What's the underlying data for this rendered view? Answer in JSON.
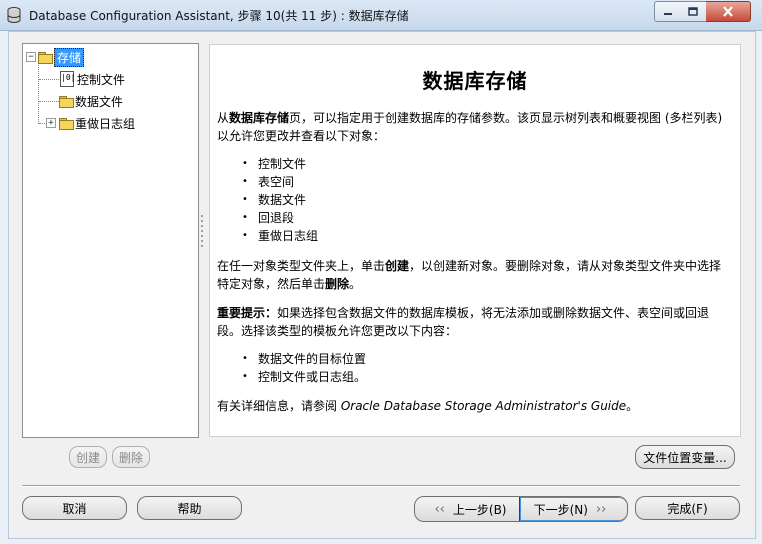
{
  "window": {
    "title": "Database Configuration Assistant, 步骤 10(共 11 步) : 数据库存储",
    "app_icon": "database-app-icon",
    "controls": [
      "minimize-icon",
      "maximize-icon",
      "close-icon"
    ]
  },
  "tree": {
    "root_label": "存储",
    "items": [
      {
        "label": "控制文件",
        "icon": "control-file-icon"
      },
      {
        "label": "数据文件",
        "icon": "folder-icon"
      },
      {
        "label": "重做日志组",
        "icon": "folder-icon"
      }
    ]
  },
  "content": {
    "title": "数据库存储",
    "intro_prefix": "从",
    "intro_bold": "数据库存储",
    "intro_rest": "页，可以指定用于创建数据库的存储参数。该页显示树列表和概要视图 (多栏列表) 以允许您更改并查看以下对象：",
    "objects": [
      "控制文件",
      "表空间",
      "数据文件",
      "回退段",
      "重做日志组"
    ],
    "create_para": {
      "p1": "在任一对象类型文件夹上，单击",
      "b1": "创建",
      "p2": "，以创建新对象。要删除对象，请从对象类型文件夹中选择特定对象，然后单击",
      "b2": "删除",
      "p3": "。"
    },
    "note": {
      "label": "重要提示：",
      "text": "如果选择包含数据文件的数据库模板，将无法添加或删除数据文件、表空间或回退段。选择该类型的模板允许您更改以下内容："
    },
    "changeable": [
      "数据文件的目标位置",
      "控制文件或日志组。"
    ],
    "more_info_prefix": "有关详细信息，请参阅 ",
    "more_info_guide": "Oracle Database Storage Administrator's Guide",
    "more_info_suffix": "。"
  },
  "buttons": {
    "create": "创建",
    "delete": "删除",
    "file_location": "文件位置变量...",
    "cancel": "取消",
    "help": "帮助",
    "back": "上一步(B)",
    "next": "下一步(N)",
    "finish": "完成(F)"
  }
}
